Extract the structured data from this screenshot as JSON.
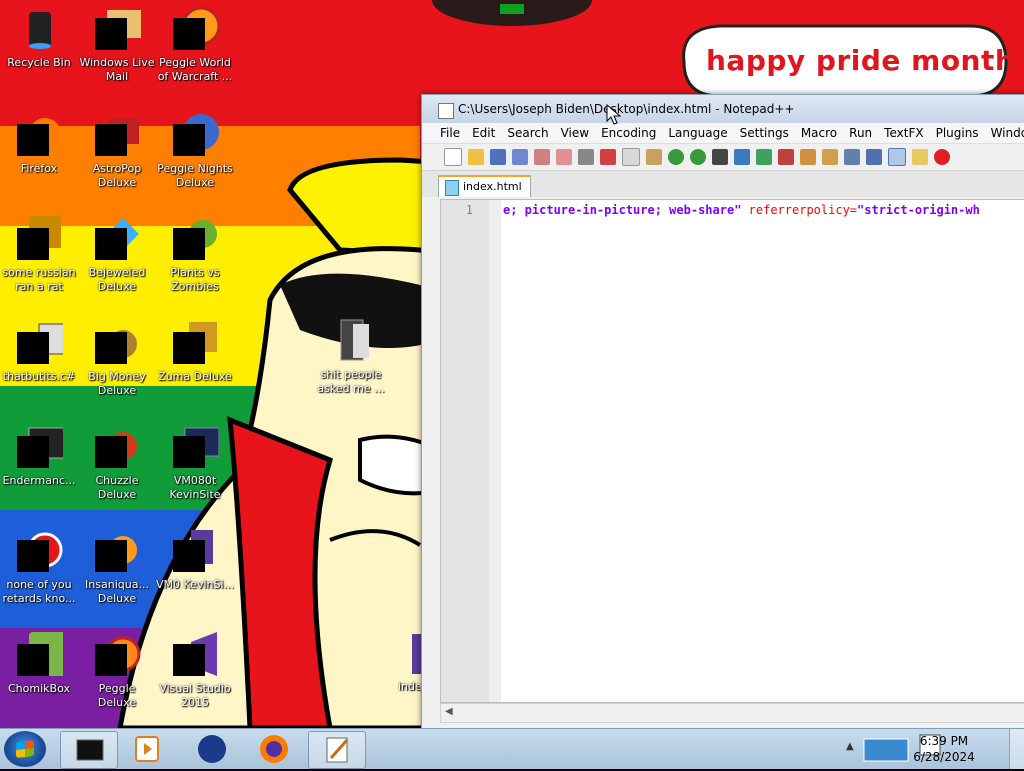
{
  "desktop": {
    "bubble_text": "happy pride month",
    "stripe_colors": [
      "#e8141b",
      "#ff7f00",
      "#ffee00",
      "#ffee00",
      "#119c3a",
      "#1e5fd9",
      "#7b1fa2"
    ],
    "icons": [
      {
        "label": "Recycle Bin"
      },
      {
        "label": "Windows Live Mail"
      },
      {
        "label": "Peggle World of Warcraft ..."
      },
      {
        "label": "Firefox"
      },
      {
        "label": "AstroPop Deluxe"
      },
      {
        "label": "Peggle Nights Deluxe"
      },
      {
        "label": "some russian ran a rat"
      },
      {
        "label": "Bejeweled Deluxe"
      },
      {
        "label": "Plants vs Zombies"
      },
      {
        "label": "thatbutits.c#"
      },
      {
        "label": "Big Money Deluxe"
      },
      {
        "label": "Zuma Deluxe"
      },
      {
        "label": "Endermanc..."
      },
      {
        "label": "Chuzzle Deluxe"
      },
      {
        "label": "VM080t KevinSite"
      },
      {
        "label": "none of you retards kno..."
      },
      {
        "label": "Insaniqua... Deluxe"
      },
      {
        "label": "VM0 KevinSi..."
      },
      {
        "label": "ChomikBox"
      },
      {
        "label": "Peggle Deluxe"
      },
      {
        "label": "Visual Studio 2015"
      },
      {
        "label": "shit people asked me ..."
      },
      {
        "label": "inde"
      }
    ]
  },
  "notepad": {
    "title": "C:\\Users\\Joseph Biden\\Desktop\\index.html - Notepad++",
    "menu": [
      "File",
      "Edit",
      "Search",
      "View",
      "Encoding",
      "Language",
      "Settings",
      "Macro",
      "Run",
      "TextFX",
      "Plugins",
      "Window"
    ],
    "tab": "index.html",
    "line_number": "1",
    "code_a": "e; picture-in-picture; web-share\"",
    "code_b": " referrerpolicy=",
    "code_c": "\"strict-origin-wh"
  },
  "taskbar": {
    "time": "6:39 PM",
    "date": "6/28/2024"
  }
}
